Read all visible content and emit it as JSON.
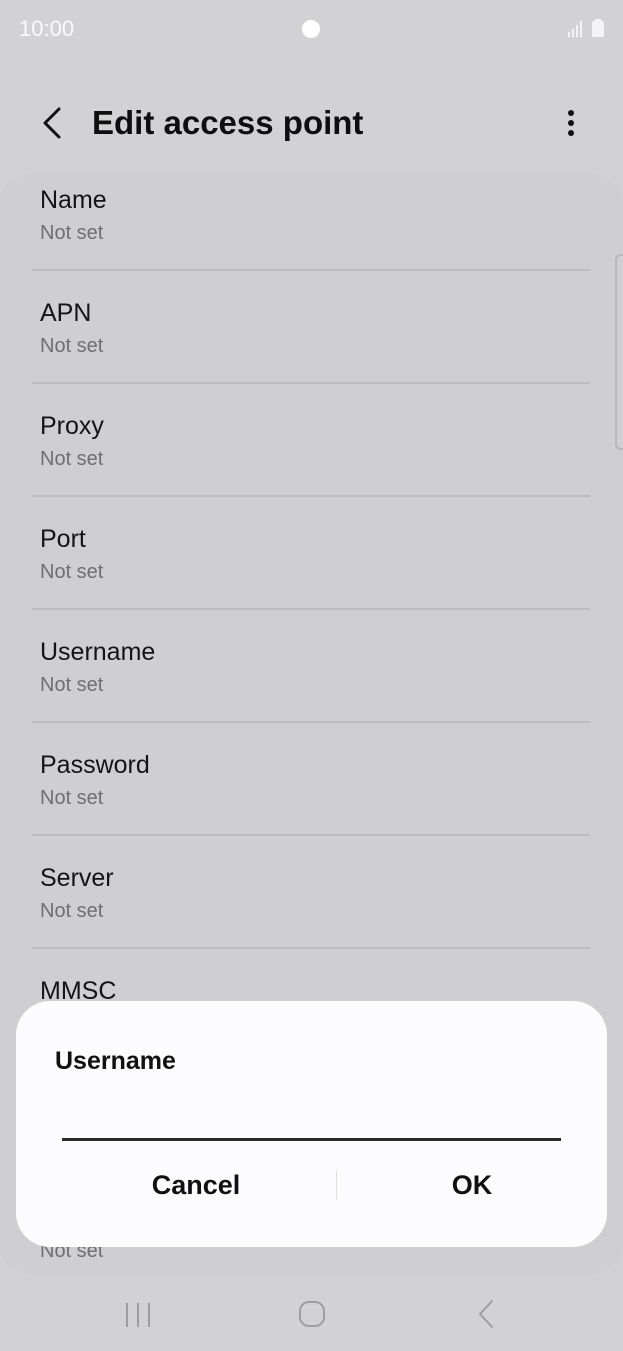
{
  "status_bar": {
    "time": "10:00"
  },
  "app_bar": {
    "title": "Edit access point"
  },
  "items": [
    {
      "title": "Name",
      "value": "Not set"
    },
    {
      "title": "APN",
      "value": "Not set"
    },
    {
      "title": "Proxy",
      "value": "Not set"
    },
    {
      "title": "Port",
      "value": "Not set"
    },
    {
      "title": "Username",
      "value": "Not set"
    },
    {
      "title": "Password",
      "value": "Not set"
    },
    {
      "title": "Server",
      "value": "Not set"
    },
    {
      "title": "MMSC",
      "value": ""
    },
    {
      "title": "",
      "value": "Not set"
    }
  ],
  "dialog": {
    "title": "Username",
    "input_value": "",
    "cancel_label": "Cancel",
    "ok_label": "OK"
  },
  "colors": {
    "accent_text": "#111111",
    "background": "#d2d2d4",
    "dialog_bg": "#fcfcfe"
  }
}
